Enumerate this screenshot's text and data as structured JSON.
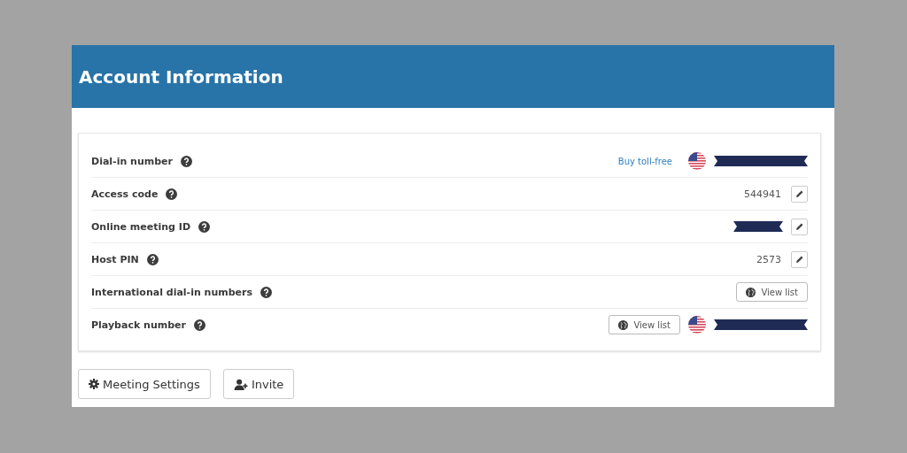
{
  "header": {
    "title": "Account Information"
  },
  "rows": [
    {
      "label": "Dial-in number",
      "items": [
        {
          "kind": "link",
          "text": "Buy toll-free"
        },
        {
          "kind": "flag"
        },
        {
          "kind": "redacted"
        }
      ]
    },
    {
      "label": "Access code",
      "items": [
        {
          "kind": "value",
          "text": "544941"
        },
        {
          "kind": "edit"
        }
      ]
    },
    {
      "label": "Online meeting ID",
      "items": [
        {
          "kind": "redacted_short"
        },
        {
          "kind": "edit"
        }
      ]
    },
    {
      "label": "Host PIN",
      "items": [
        {
          "kind": "value",
          "text": "2573"
        },
        {
          "kind": "edit"
        }
      ]
    },
    {
      "label": "International dial-in numbers",
      "items": [
        {
          "kind": "view_list",
          "text": "View list"
        }
      ]
    },
    {
      "label": "Playback number",
      "items": [
        {
          "kind": "view_list",
          "text": "View list"
        },
        {
          "kind": "flag"
        },
        {
          "kind": "redacted"
        }
      ]
    }
  ],
  "buttons": [
    {
      "kind": "settings",
      "label": "Meeting Settings"
    },
    {
      "kind": "invite",
      "label": "Invite"
    }
  ]
}
